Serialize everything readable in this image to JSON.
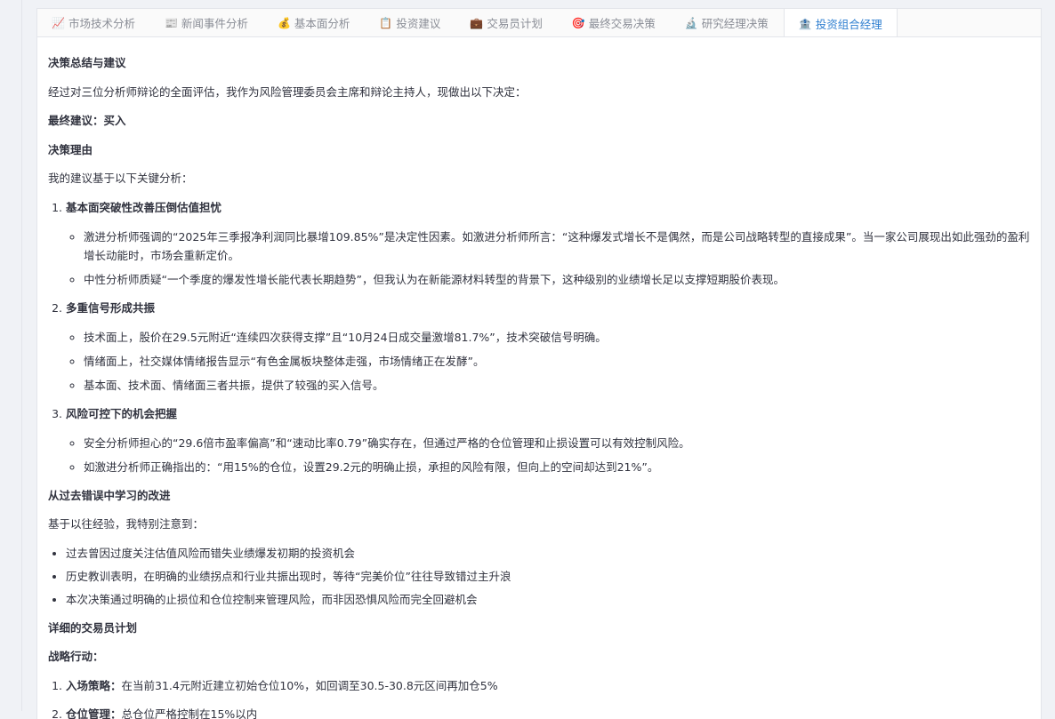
{
  "tabs": [
    {
      "icon": "📈",
      "label": "市场技术分析"
    },
    {
      "icon": "📰",
      "label": "新闻事件分析"
    },
    {
      "icon": "💰",
      "label": "基本面分析"
    },
    {
      "icon": "📋",
      "label": "投资建议"
    },
    {
      "icon": "💼",
      "label": "交易员计划"
    },
    {
      "icon": "🎯",
      "label": "最终交易决策"
    },
    {
      "icon": "🔬",
      "label": "研究经理决策"
    },
    {
      "icon": "🏦",
      "label": "投资组合经理"
    }
  ],
  "content": {
    "heading_summary": "决策总结与建议",
    "intro": "经过对三位分析师辩论的全面评估，我作为风险管理委员会主席和辩论主持人，现做出以下决定：",
    "final_label": "最终建议：",
    "final_value": "买入",
    "heading_reason": "决策理由",
    "reason_intro": "我的建议基于以下关键分析：",
    "reasons": [
      {
        "title": "基本面突破性改善压倒估值担忧",
        "points": [
          "激进分析师强调的“2025年三季报净利润同比暴增109.85%”是决定性因素。如激进分析师所言：“这种爆发式增长不是偶然，而是公司战略转型的直接成果”。当一家公司展现出如此强劲的盈利增长动能时，市场会重新定价。",
          "中性分析师质疑“一个季度的爆发性增长能代表长期趋势”，但我认为在新能源材料转型的背景下，这种级别的业绩增长足以支撑短期股价表现。"
        ]
      },
      {
        "title": "多重信号形成共振",
        "points": [
          "技术面上，股价在29.5元附近“连续四次获得支撑”且“10月24日成交量激增81.7%”，技术突破信号明确。",
          "情绪面上，社交媒体情绪报告显示“有色金属板块整体走强，市场情绪正在发酵”。",
          "基本面、技术面、情绪面三者共振，提供了较强的买入信号。"
        ]
      },
      {
        "title": "风险可控下的机会把握",
        "points": [
          "安全分析师担心的“29.6倍市盈率偏高”和“速动比率0.79”确实存在，但通过严格的仓位管理和止损设置可以有效控制风险。",
          "如激进分析师正确指出的：“用15%的仓位，设置29.2元的明确止损，承担的风险有限，但向上的空间却达到21%”。"
        ]
      }
    ],
    "heading_learn": "从过去错误中学习的改进",
    "learn_intro": "基于以往经验，我特别注意到：",
    "lessons": [
      "过去曾因过度关注估值风险而错失业绩爆发初期的投资机会",
      "历史教训表明，在明确的业绩拐点和行业共振出现时，等待“完美价位”往往导致错过主升浪",
      "本次决策通过明确的止损位和仓位控制来管理风险，而非因恐惧风险而完全回避机会"
    ],
    "heading_plan": "详细的交易员计划",
    "heading_strategy": "战略行动：",
    "plan": [
      {
        "label": "入场策略：",
        "text": "在当前31.4元附近建立初始仓位10%，如回调至30.5-30.8元区间再加仓5%"
      },
      {
        "label": "仓位管理：",
        "text": "总仓位严格控制在15%以内"
      }
    ]
  }
}
